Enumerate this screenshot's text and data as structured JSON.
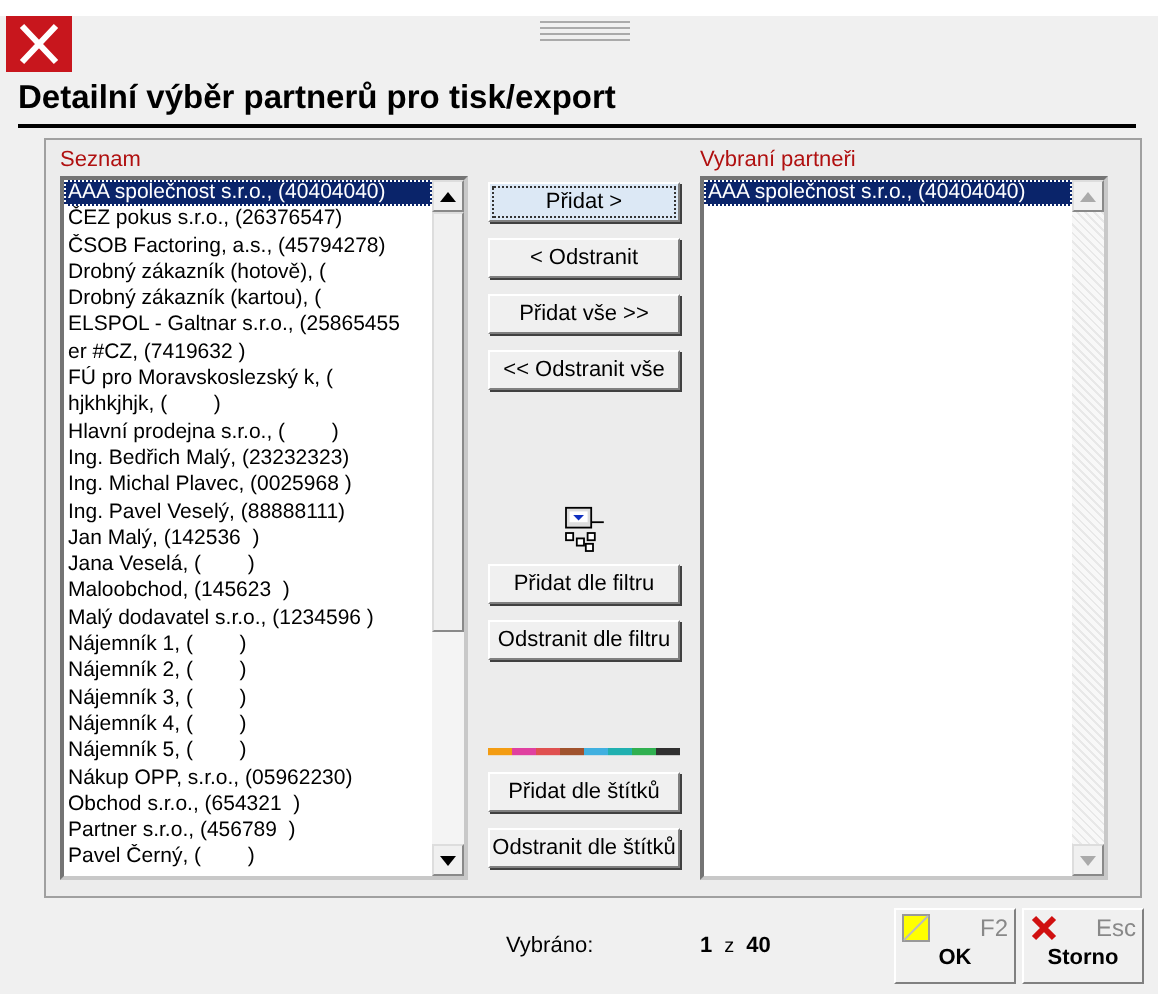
{
  "window": {
    "title": "Detailní výběr partnerů pro tisk/export"
  },
  "available": {
    "label": "Seznam",
    "items": [
      {
        "text": "AAA společnost s.r.o., (40404040)",
        "selected": true
      },
      {
        "text": "ČEZ pokus s.r.o., (26376547)",
        "selected": false
      },
      {
        "text": "ČSOB Factoring, a.s., (45794278)",
        "selected": false
      },
      {
        "text": "Drobný zákazník (hotově), (",
        "selected": false
      },
      {
        "text": "Drobný zákazník (kartou), (",
        "selected": false
      },
      {
        "text": "ELSPOL - Galtnar s.r.o., (25865455",
        "selected": false
      },
      {
        "text": "er #CZ, (7419632 )",
        "selected": false
      },
      {
        "text": "FÚ pro Moravskoslezský k, (",
        "selected": false
      },
      {
        "text": "hjkhkjhjk, (        )",
        "selected": false
      },
      {
        "text": "Hlavní prodejna s.r.o., (        )",
        "selected": false
      },
      {
        "text": "Ing. Bedřich Malý, (23232323)",
        "selected": false
      },
      {
        "text": "Ing. Michal Plavec, (0025968 )",
        "selected": false
      },
      {
        "text": "Ing. Pavel Veselý, (88888111)",
        "selected": false
      },
      {
        "text": "Jan Malý, (142536  )",
        "selected": false
      },
      {
        "text": "Jana Veselá, (        )",
        "selected": false
      },
      {
        "text": "Maloobchod, (145623  )",
        "selected": false
      },
      {
        "text": "Malý dodavatel s.r.o., (1234596 )",
        "selected": false
      },
      {
        "text": "Nájemník 1, (        )",
        "selected": false
      },
      {
        "text": "Nájemník 2, (        )",
        "selected": false
      },
      {
        "text": "Nájemník 3, (        )",
        "selected": false
      },
      {
        "text": "Nájemník 4, (        )",
        "selected": false
      },
      {
        "text": "Nájemník 5, (        )",
        "selected": false
      },
      {
        "text": "Nákup OPP, s.r.o., (05962230)",
        "selected": false
      },
      {
        "text": "Obchod s.r.o., (654321  )",
        "selected": false
      },
      {
        "text": "Partner s.r.o., (456789  )",
        "selected": false
      },
      {
        "text": "Pavel Černý, (        )",
        "selected": false
      }
    ]
  },
  "actions": [
    {
      "label": "Přidat >",
      "focused": true,
      "kind": "button"
    },
    {
      "label": "< Odstranit",
      "focused": false,
      "kind": "button"
    },
    {
      "label": "Přidat vše >>",
      "focused": false,
      "kind": "button"
    },
    {
      "label": "<< Odstranit vše",
      "focused": false,
      "kind": "button"
    },
    {
      "kind": "filter-icon"
    },
    {
      "label": "Přidat dle filtru",
      "focused": false,
      "kind": "button"
    },
    {
      "label": "Odstranit dle filtru",
      "focused": false,
      "kind": "button"
    },
    {
      "kind": "tag-strip"
    },
    {
      "label": "Přidat dle štítků",
      "focused": false,
      "kind": "button"
    },
    {
      "label": "Odstranit dle štítků",
      "focused": false,
      "kind": "button"
    }
  ],
  "selected_list": {
    "label": "Vybraní partneři",
    "items": [
      {
        "text": "AAA společnost s.r.o., (40404040)",
        "selected": true
      }
    ]
  },
  "footer": {
    "label": "Vybráno:",
    "count": "1",
    "of": "z",
    "total": "40",
    "buttons": [
      {
        "kind": "ok",
        "key": "F2",
        "label": "OK"
      },
      {
        "kind": "cancel",
        "key": "Esc",
        "label": "Storno"
      }
    ]
  }
}
